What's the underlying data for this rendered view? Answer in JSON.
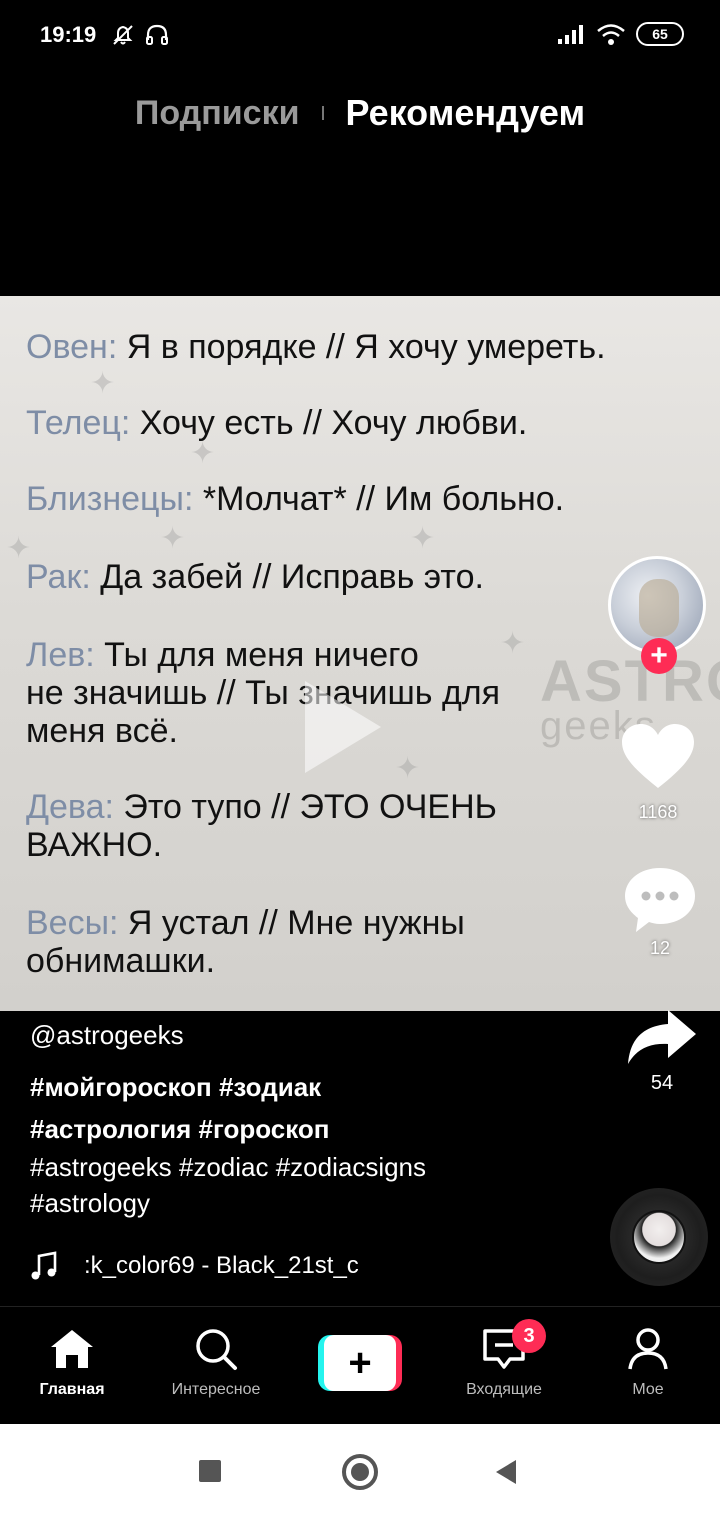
{
  "status_bar": {
    "time": "19:19",
    "battery": "65"
  },
  "top_tabs": {
    "following": "Подписки",
    "for_you": "Рекомендуем"
  },
  "video": {
    "watermark_line1": "ASTRO",
    "watermark_line2": "geeks",
    "lines": [
      {
        "sign": "Овен:",
        "text": " Я в порядке // Я хочу умереть."
      },
      {
        "sign": "Телец:",
        "text": " Хочу есть // Хочу любви."
      },
      {
        "sign": "Близнецы:",
        "text": " *Молчат* // Им больно."
      },
      {
        "sign": "Рак:",
        "text": " Да забей // Исправь это."
      },
      {
        "sign": "Лев:",
        "text": " Ты для меня ничего"
      },
      {
        "sign": "",
        "text": "не значишь // Ты значишь для"
      },
      {
        "sign": "",
        "text": "меня всё."
      },
      {
        "sign": "Дева:",
        "text": " Это тупо // ЭТО ОЧЕНЬ"
      },
      {
        "sign": "",
        "text": "ВАЖНО."
      },
      {
        "sign": "Весы:",
        "text": " Я устал // Мне нужны"
      },
      {
        "sign": "",
        "text": "обнимашки."
      }
    ]
  },
  "rail": {
    "likes": "1168",
    "comments": "12",
    "shares": "54"
  },
  "caption": {
    "username": "@astrogeeks",
    "hashtags_line1": "#мойгороскоп #зодиак",
    "hashtags_line2": "#астрология #гороскоп",
    "hashtags_line3": "#astrogeeks #zodiac #zodiacsigns",
    "hashtags_line4": "#astrology",
    "music": ":k_color69 - Black_21st_c"
  },
  "bottom_nav": {
    "home": "Главная",
    "discover": "Интересное",
    "create": "+",
    "inbox": "Входящие",
    "inbox_badge": "3",
    "profile": "Мое"
  },
  "colors": {
    "accent_red": "#fe2c55",
    "accent_cyan": "#25f4ee",
    "zodiac_sign": "#7e8da6"
  }
}
